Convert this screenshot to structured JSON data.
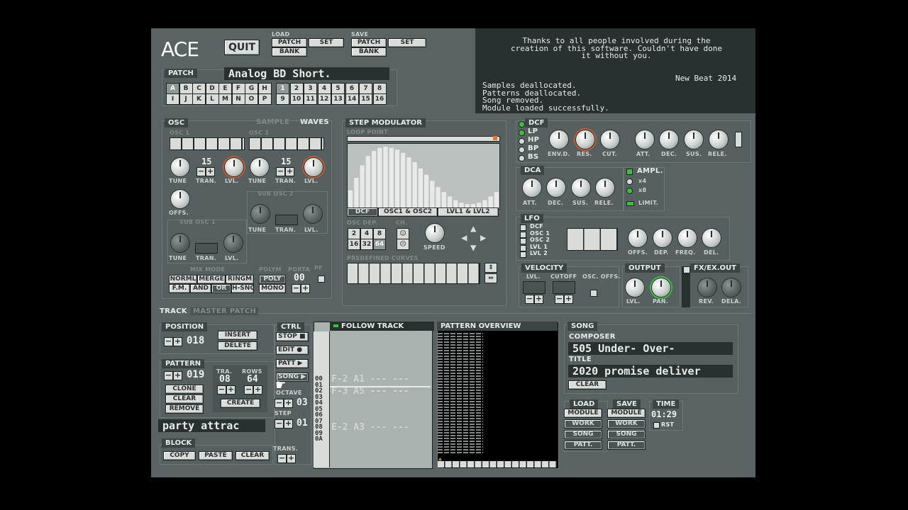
{
  "app": {
    "logo": "ACE",
    "quit_label": "QUIT"
  },
  "load": {
    "title": "LOAD",
    "patch": "PATCH",
    "set": "SET",
    "bank": "BANK"
  },
  "save": {
    "title": "SAVE",
    "patch": "PATCH",
    "set": "SET",
    "bank": "BANK"
  },
  "messages": {
    "thanks": "Thanks to all people involved during the\ncreation of this software. Couldn't have done\nit without you.",
    "signature": "New Beat 2014",
    "log": "Samples deallocated.\nPatterns deallocated.\nSong removed.\nModule loaded successfully."
  },
  "patch": {
    "title": "PATCH",
    "name": "Analog BD Short.",
    "letters_row1": [
      "A",
      "B",
      "C",
      "D",
      "E",
      "F",
      "G",
      "H"
    ],
    "letters_row2": [
      "I",
      "J",
      "K",
      "L",
      "M",
      "N",
      "O",
      "P"
    ],
    "numbers_row1": [
      "1",
      "2",
      "3",
      "4",
      "5",
      "6",
      "7",
      "8"
    ],
    "numbers_row2": [
      "9",
      "10",
      "11",
      "12",
      "13",
      "14",
      "15",
      "16"
    ]
  },
  "osc": {
    "title": "OSC",
    "sample_label": "SAMPLE",
    "waves_label": "WAVES",
    "osc1": "OSC 1",
    "osc2": "OSC 2",
    "tran1": "15",
    "tran2": "15",
    "tune": "TUNE",
    "tran": "TRAN.",
    "lvl": "LVL.",
    "offs": "OFFS.",
    "sub_osc1": "SUB OSC 1",
    "sub_osc2": "SUB OSC 2",
    "mix_mode": "MIX MODE",
    "mix_buttons_row1": [
      "NORML",
      "MERGE",
      "RINGM"
    ],
    "mix_buttons_row2": [
      "F.M.",
      "AND",
      "OR",
      "H-SNC"
    ],
    "polym": "POLYM",
    "poly": "POLY",
    "mono": "MONO",
    "porta": "PORTA",
    "porta_value": "00",
    "pf": "PF"
  },
  "step_mod": {
    "title": "STEP MODULATOR",
    "loop_point": "LOOP POINT",
    "tabs": [
      "DCF",
      "OSC1 & OSC2",
      "LVL1 & LVL2"
    ],
    "osc_dep": "OSC DEP.",
    "ch": "CH.",
    "dep_buttons": [
      "2",
      "4",
      "8",
      "16",
      "32",
      "64"
    ],
    "speed": "SPEED",
    "predefined": "PREDEFINED CURVES",
    "bars": [
      0.3,
      0.5,
      0.7,
      0.85,
      0.93,
      0.98,
      1.0,
      0.98,
      0.95,
      0.9,
      0.83,
      0.75,
      0.65,
      0.55,
      0.45,
      0.35,
      0.27,
      0.2,
      0.14,
      0.1,
      0.08,
      0.08,
      0.1,
      0.14,
      0.2,
      0.27
    ]
  },
  "dcf": {
    "title": "DCF",
    "modes": [
      "LP",
      "HP",
      "BP",
      "BS"
    ],
    "knobs": [
      "ENV.D.",
      "RES.",
      "CUT.",
      "ATT.",
      "DEC.",
      "SUS.",
      "RELE."
    ]
  },
  "dca": {
    "title": "DCA",
    "knobs": [
      "ATT.",
      "DEC.",
      "SUS.",
      "RELE."
    ],
    "ampl": "AMPL.",
    "x4": "x4",
    "x8": "x8",
    "limit": "LIMIT."
  },
  "lfo": {
    "title": "LFO",
    "targets": [
      "DCF",
      "OSC 1",
      "OSC 2",
      "LVL 1",
      "LVL 2"
    ],
    "knobs": [
      "OFFS.",
      "DEP.",
      "FREQ.",
      "DEL."
    ]
  },
  "velocity": {
    "title": "VELOCITY",
    "lvl": "LVL.",
    "cutoff": "CUTOFF",
    "osc_offs": "OSC. OFFS."
  },
  "output": {
    "title": "OUTPUT",
    "lvl": "LVL.",
    "pan": "PAN."
  },
  "fx": {
    "title": "FX/EX.OUT",
    "rev": "REV.",
    "dela": "DELA."
  },
  "track_tabs": {
    "track": "TRACK",
    "master": "MASTER PATCH"
  },
  "position": {
    "title": "POSITION",
    "value": "018",
    "insert": "INSERT",
    "delete": "DELETE"
  },
  "pattern": {
    "title": "PATTERN",
    "value": "019",
    "tra": "TRA.",
    "rows": "ROWS",
    "tra_value": "08",
    "rows_value": "64",
    "clone": "CLONE",
    "clear": "CLEAR",
    "remove": "REMOVE",
    "create": "CREATE",
    "name": "party attrac"
  },
  "ctrl": {
    "title": "CTRL",
    "stop": "STOP",
    "edit": "EDIT",
    "patt": "PATT",
    "song": "SONG",
    "octave": "OCTAVE",
    "octave_value": "03",
    "step": "STEP",
    "step_value": "01",
    "trans": "TRANS."
  },
  "block": {
    "title": "BLOCK",
    "copy": "COPY",
    "paste": "PASTE",
    "clear": "CLEAR"
  },
  "follow": {
    "title": "FOLLOW TRACK",
    "rows": [
      {
        "n": "00",
        "note": "F-2 A1 --- ---"
      },
      {
        "n": "01",
        "note": ""
      },
      {
        "n": "02",
        "note": "F-3 A5 --- ---"
      },
      {
        "n": "03",
        "note": ""
      },
      {
        "n": "04",
        "note": ""
      },
      {
        "n": "05",
        "note": ""
      },
      {
        "n": "06",
        "note": ""
      },
      {
        "n": "07",
        "note": ""
      },
      {
        "n": "08",
        "note": "E-2 A3 --- ---"
      },
      {
        "n": "09",
        "note": ""
      },
      {
        "n": "0A",
        "note": ""
      }
    ]
  },
  "overview": {
    "title": "PATTERN OVERVIEW"
  },
  "song": {
    "title": "SONG",
    "composer_label": "COMPOSER",
    "composer": "505  Under- Over-",
    "title_label": "TITLE",
    "title_value": "2020 promise deliver",
    "clear": "CLEAR"
  },
  "io": {
    "load": "LOAD",
    "save": "SAVE",
    "items": [
      "MODULE",
      "WORK",
      "SONG",
      "PATT."
    ],
    "time_label": "TIME",
    "time": "01:29",
    "rst": "RST"
  }
}
